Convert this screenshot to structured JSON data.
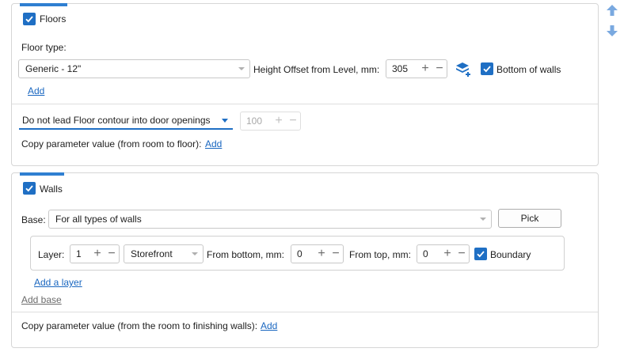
{
  "floors": {
    "title": "Floors",
    "floor_type_label": "Floor type:",
    "floor_type_value": "Generic - 12\"",
    "height_offset_label": "Height Offset from Level, mm:",
    "height_offset_value": "305",
    "bottom_of_walls_label": "Bottom of walls",
    "add_link": "Add",
    "contour_option": "Do not lead Floor contour into door openings",
    "contour_value": "100",
    "copy_param_label": "Copy parameter value (from room to floor):",
    "copy_param_link": "Add"
  },
  "walls": {
    "title": "Walls",
    "base_label": "Base:",
    "base_value": "For all types of walls",
    "pick_button": "Pick",
    "layer_label": "Layer:",
    "layer_value": "1",
    "material_value": "Storefront",
    "from_bottom_label": "From bottom, mm:",
    "from_bottom_value": "0",
    "from_top_label": "From top, mm:",
    "from_top_value": "0",
    "boundary_label": "Boundary",
    "add_layer_link": "Add a layer",
    "add_base_link": "Add base",
    "copy_param_label": "Copy parameter value (from the room to finishing walls):",
    "copy_param_link": "Add"
  },
  "icons": {
    "move_up": "arrow-up-icon",
    "move_down": "arrow-down-icon",
    "layers_add": "layers-add-icon"
  },
  "colors": {
    "accent": "#1f6fc4",
    "link": "#1a67c0",
    "arrow": "#7aa9e0"
  }
}
